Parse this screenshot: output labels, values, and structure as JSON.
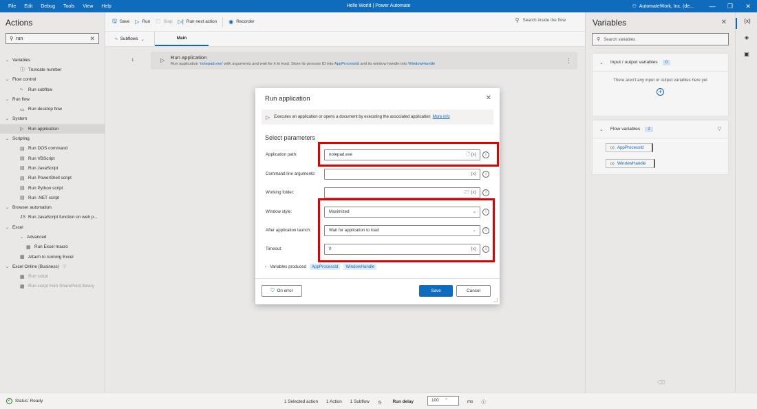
{
  "titlebar": {
    "menu": [
      "File",
      "Edit",
      "Debug",
      "Tools",
      "View",
      "Help"
    ],
    "title": "Hello World | Power Automate",
    "account": "AutomateWork, Inc. (de..."
  },
  "actions_pane": {
    "title": "Actions",
    "search_value": "run",
    "tree": [
      {
        "label": "Variables",
        "level": 0,
        "group": true
      },
      {
        "label": "Truncate number",
        "level": 1,
        "icon": "ⓘ"
      },
      {
        "label": "Flow control",
        "level": 0,
        "group": true
      },
      {
        "label": "Run subflow",
        "level": 1,
        "icon": "⤷"
      },
      {
        "label": "Run flow",
        "level": 0,
        "group": true
      },
      {
        "label": "Run desktop flow",
        "level": 1,
        "icon": "▭"
      },
      {
        "label": "System",
        "level": 0,
        "group": true
      },
      {
        "label": "Run application",
        "level": 1,
        "icon": "▷",
        "selected": true
      },
      {
        "label": "Scripting",
        "level": 0,
        "group": true
      },
      {
        "label": "Run DOS command",
        "level": 1,
        "icon": "▤"
      },
      {
        "label": "Run VBScript",
        "level": 1,
        "icon": "▤"
      },
      {
        "label": "Run JavaScript",
        "level": 1,
        "icon": "▤"
      },
      {
        "label": "Run PowerShell script",
        "level": 1,
        "icon": "▤"
      },
      {
        "label": "Run Python script",
        "level": 1,
        "icon": "▤"
      },
      {
        "label": "Run .NET script",
        "level": 1,
        "icon": "▤"
      },
      {
        "label": "Browser automation",
        "level": 0,
        "group": true
      },
      {
        "label": "Run JavaScript function on web p...",
        "level": 1,
        "icon": "JS"
      },
      {
        "label": "Excel",
        "level": 0,
        "group": true
      },
      {
        "label": "Advanced",
        "level": 1,
        "group": true
      },
      {
        "label": "Run Excel macro",
        "level": 2,
        "icon": "▦"
      },
      {
        "label": "Attach to running Excel",
        "level": 1,
        "icon": "▦"
      },
      {
        "label": "Excel Online (Business)",
        "level": 0,
        "group": true,
        "badge": "♡"
      },
      {
        "label": "Run script",
        "level": 1,
        "icon": "▦",
        "disabled": true
      },
      {
        "label": "Run script from SharePoint library",
        "level": 1,
        "icon": "▦",
        "disabled": true
      }
    ]
  },
  "toolbar": {
    "save": "Save",
    "run": "Run",
    "stop": "Stop",
    "run_next": "Run next action",
    "recorder": "Recorder",
    "search_placeholder": "Search inside the flow"
  },
  "tabs": {
    "subflows": "Subflows",
    "main": "Main"
  },
  "flow": {
    "line_number": "1",
    "action_name": "Run application",
    "desc_1": "Run application ",
    "desc_app": "'notepad.exe'",
    "desc_2": " with arguments  and wait for it to load. Store its process ID into ",
    "desc_var1": "AppProcessId",
    "desc_3": " and its window handle into ",
    "desc_var2": "WindowHandle"
  },
  "dialog": {
    "title": "Run application",
    "description": "Executes an application or opens a document by executing the associated application",
    "more_info": "More info",
    "section": "Select parameters",
    "fields": {
      "app_path_label": "Application path:",
      "app_path_value": "notepad.exe",
      "cmd_label": "Command line arguments:",
      "cmd_value": "",
      "workdir_label": "Working folder:",
      "workdir_value": "",
      "winstyle_label": "Window style:",
      "winstyle_value": "Maximized",
      "after_label": "After application launch:",
      "after_value": "Wait for application to load",
      "timeout_label": "Timeout:",
      "timeout_value": "0"
    },
    "vars_produced_label": "Variables produced",
    "vars_produced": [
      "AppProcessId",
      "WindowHandle"
    ],
    "on_error": "On error",
    "save": "Save",
    "cancel": "Cancel"
  },
  "variables_pane": {
    "title": "Variables",
    "search_placeholder": "Search variables",
    "io_title": "Input / output variables",
    "io_count": "0",
    "io_empty": "There aren't any input or output variables here yet",
    "flow_title": "Flow variables",
    "flow_count": "2",
    "flow_vars": [
      "AppProcessId",
      "WindowHandle"
    ]
  },
  "statusbar": {
    "status": "Status: Ready",
    "selected": "1 Selected action",
    "actions": "1 Action",
    "subflow": "1 Subflow",
    "run_delay_label": "Run delay",
    "run_delay_value": "100",
    "ms": "ms"
  },
  "colors": {
    "accent": "#0f6cbd",
    "highlight": "#e00000"
  }
}
